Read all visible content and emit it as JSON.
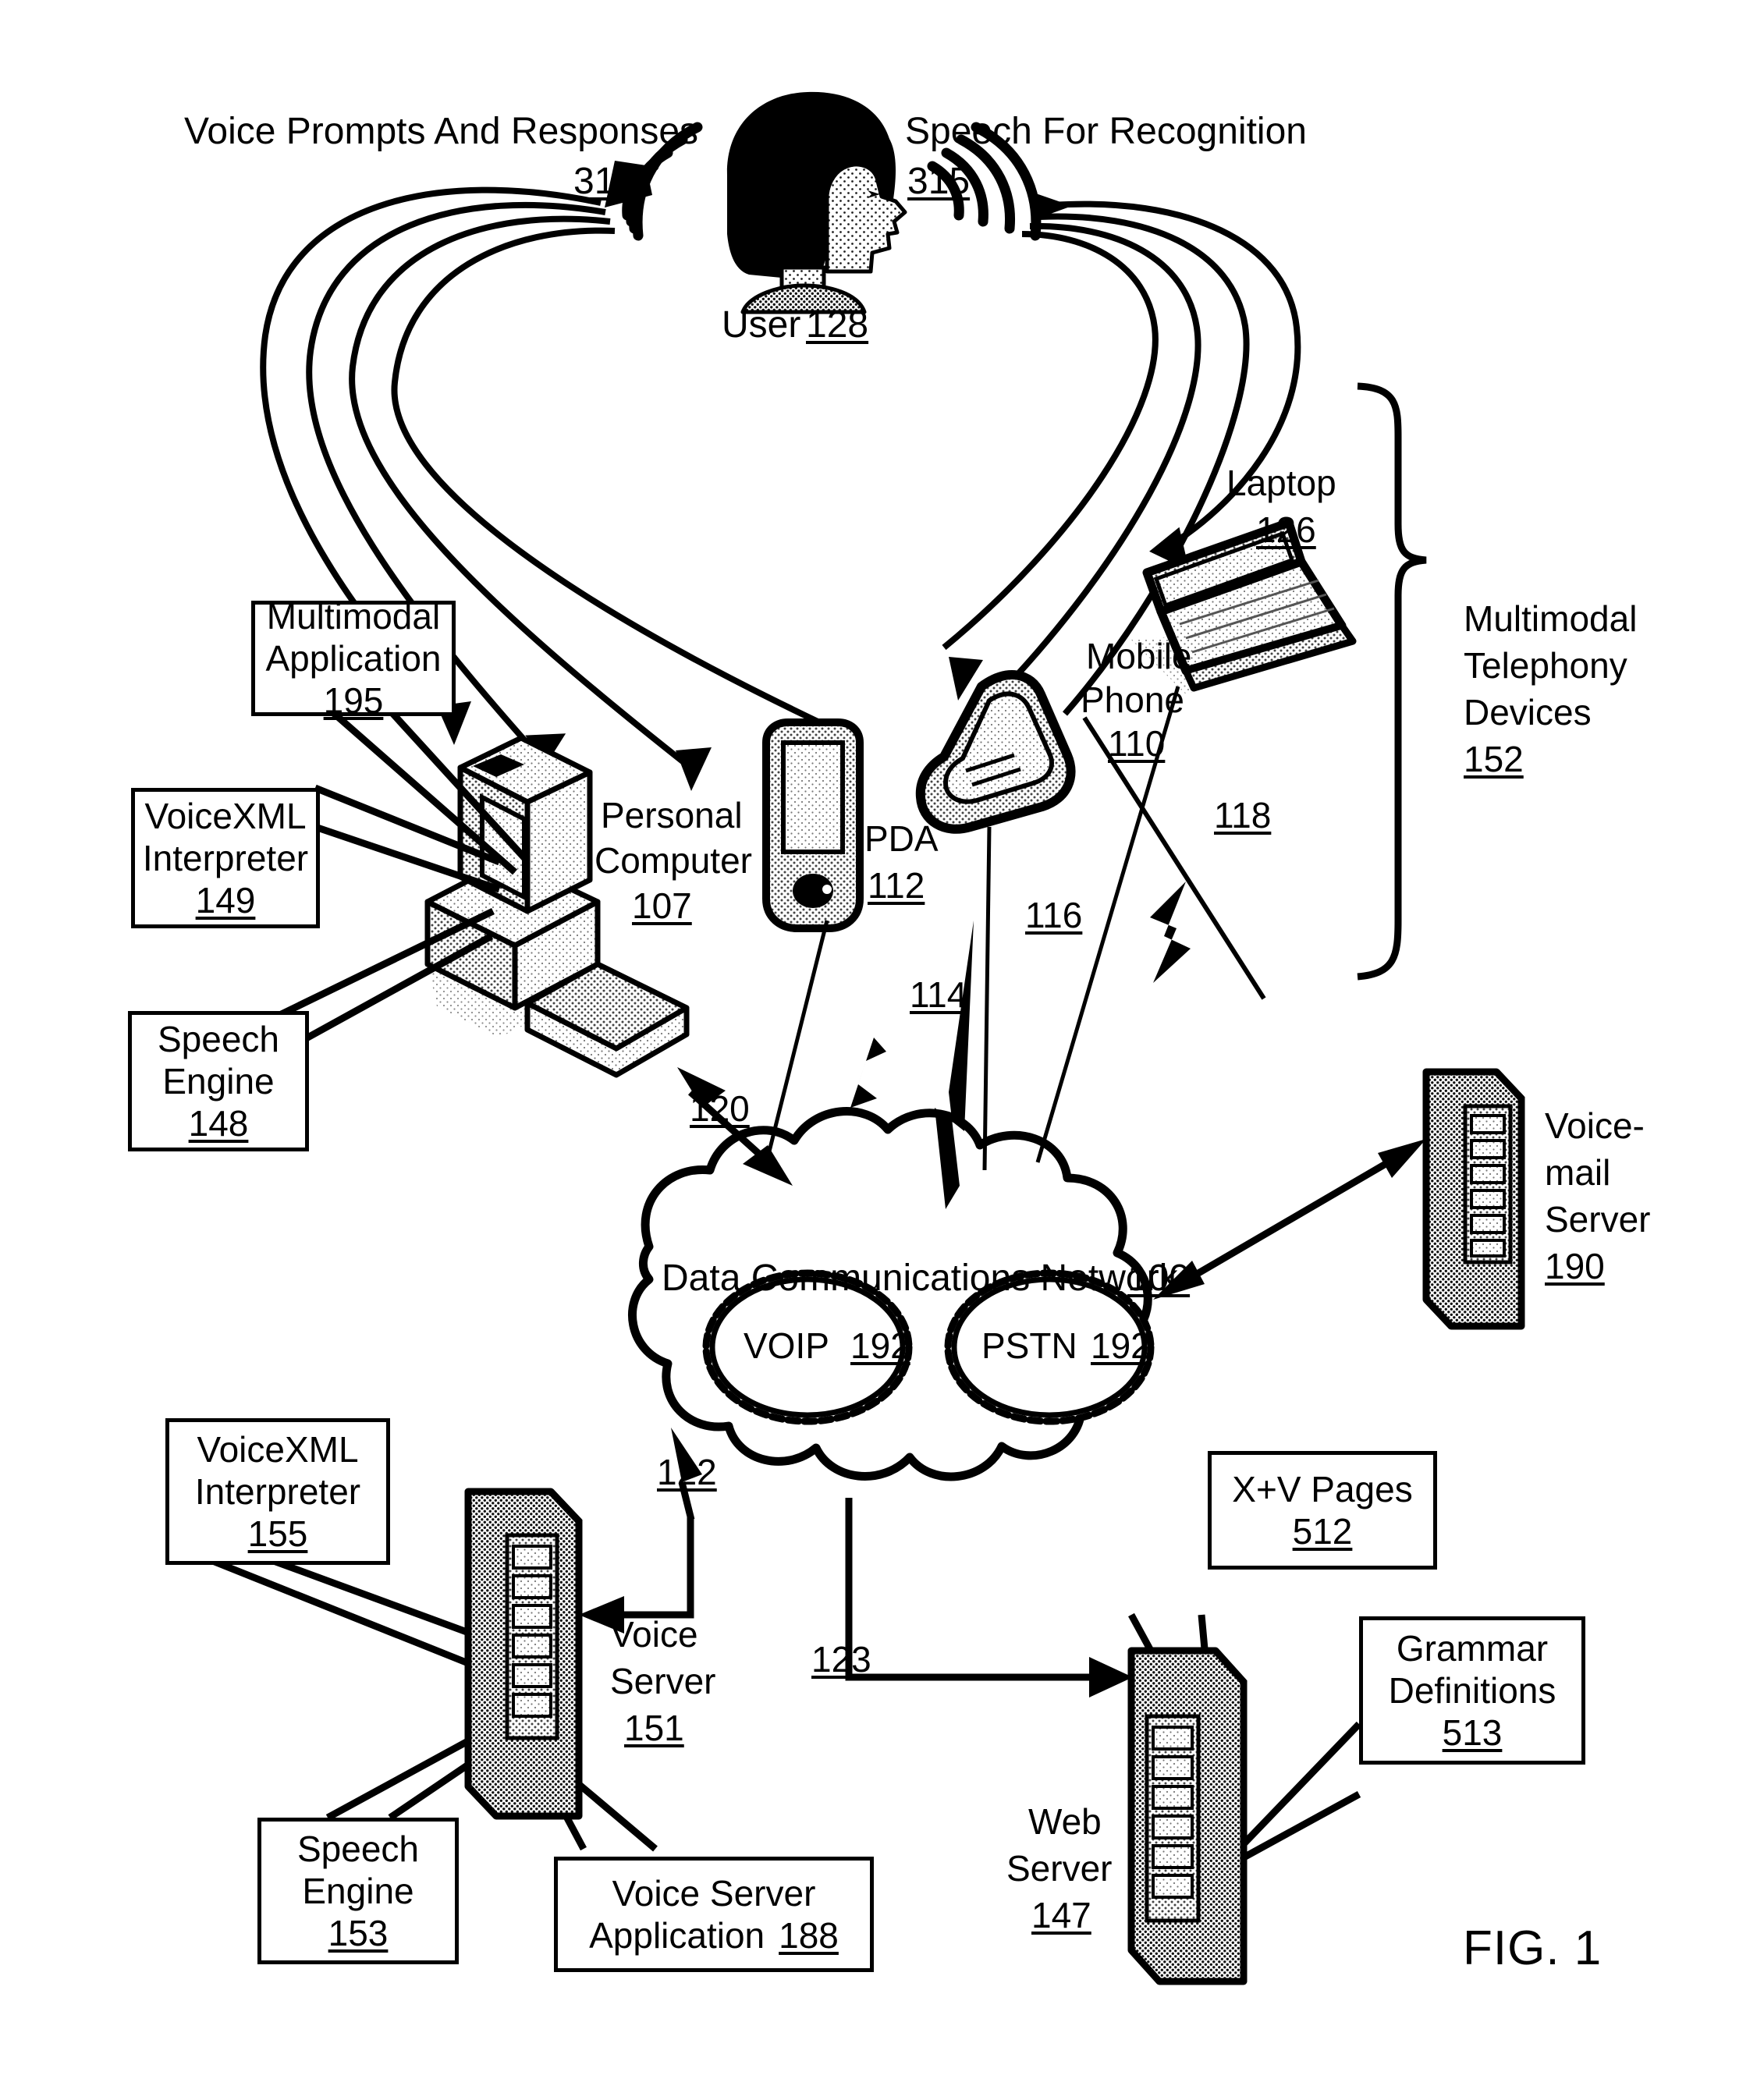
{
  "figure": {
    "caption": "FIG. 1"
  },
  "annotations": {
    "voice_prompts": {
      "text": "Voice Prompts And Responses",
      "ref": "314"
    },
    "speech_recognition": {
      "text": "Speech For Recognition",
      "ref": "315"
    },
    "user": {
      "text": "User",
      "ref": "128"
    }
  },
  "callout_boxes": [
    {
      "id": "multimodal-application",
      "lines": [
        "Multimodal",
        "Application"
      ],
      "ref": "195"
    },
    {
      "id": "voicexml-interpreter-149",
      "lines": [
        "VoiceXML",
        "Interpreter"
      ],
      "ref": "149"
    },
    {
      "id": "speech-engine-148",
      "lines": [
        "Speech",
        "Engine"
      ],
      "ref": "148"
    },
    {
      "id": "voicexml-interpreter-155",
      "lines": [
        "VoiceXML",
        "Interpreter"
      ],
      "ref": "155"
    },
    {
      "id": "speech-engine-153",
      "lines": [
        "Speech",
        "Engine"
      ],
      "ref": "153"
    },
    {
      "id": "voice-server-application",
      "lines": [
        "Voice Server"
      ],
      "inline": "Application",
      "ref": "188"
    },
    {
      "id": "xv-pages",
      "lines": [
        "X+V Pages"
      ],
      "ref": "512"
    },
    {
      "id": "grammar-definitions",
      "lines": [
        "Grammar",
        "Definitions"
      ],
      "ref": "513"
    }
  ],
  "devices": [
    {
      "id": "personal-computer",
      "lines": [
        "Personal",
        "Computer"
      ],
      "ref": "107"
    },
    {
      "id": "pda",
      "lines": [
        "PDA"
      ],
      "ref": "112"
    },
    {
      "id": "mobile-phone",
      "lines": [
        "Mobile",
        "Phone"
      ],
      "ref": "110"
    },
    {
      "id": "laptop",
      "lines": [
        "Laptop"
      ],
      "ref": "126"
    },
    {
      "id": "voicemail-server",
      "lines": [
        "Voice-",
        "mail",
        "Server"
      ],
      "ref": "190"
    },
    {
      "id": "voice-server",
      "lines": [
        "Voice",
        "Server"
      ],
      "ref": "151"
    },
    {
      "id": "web-server",
      "lines": [
        "Web",
        "Server"
      ],
      "ref": "147"
    }
  ],
  "group_brace": {
    "lines": [
      "Multimodal",
      "Telephony",
      "Devices"
    ],
    "ref": "152"
  },
  "network_cloud": {
    "label": "Data Communications Network",
    "ref": "100",
    "subclouds": [
      {
        "label": "VOIP",
        "ref": "192"
      },
      {
        "label": "PSTN",
        "ref": "192"
      }
    ]
  },
  "connection_refs": [
    {
      "id": "link-120",
      "ref": "120"
    },
    {
      "id": "link-114",
      "ref": "114"
    },
    {
      "id": "link-116",
      "ref": "116"
    },
    {
      "id": "link-118",
      "ref": "118"
    },
    {
      "id": "link-122",
      "ref": "122"
    },
    {
      "id": "link-123",
      "ref": "123"
    }
  ],
  "colors": {
    "ink": "#000000",
    "paper": "#ffffff",
    "shade": "#b9b9b9",
    "shade_light": "#d8d8d8"
  }
}
